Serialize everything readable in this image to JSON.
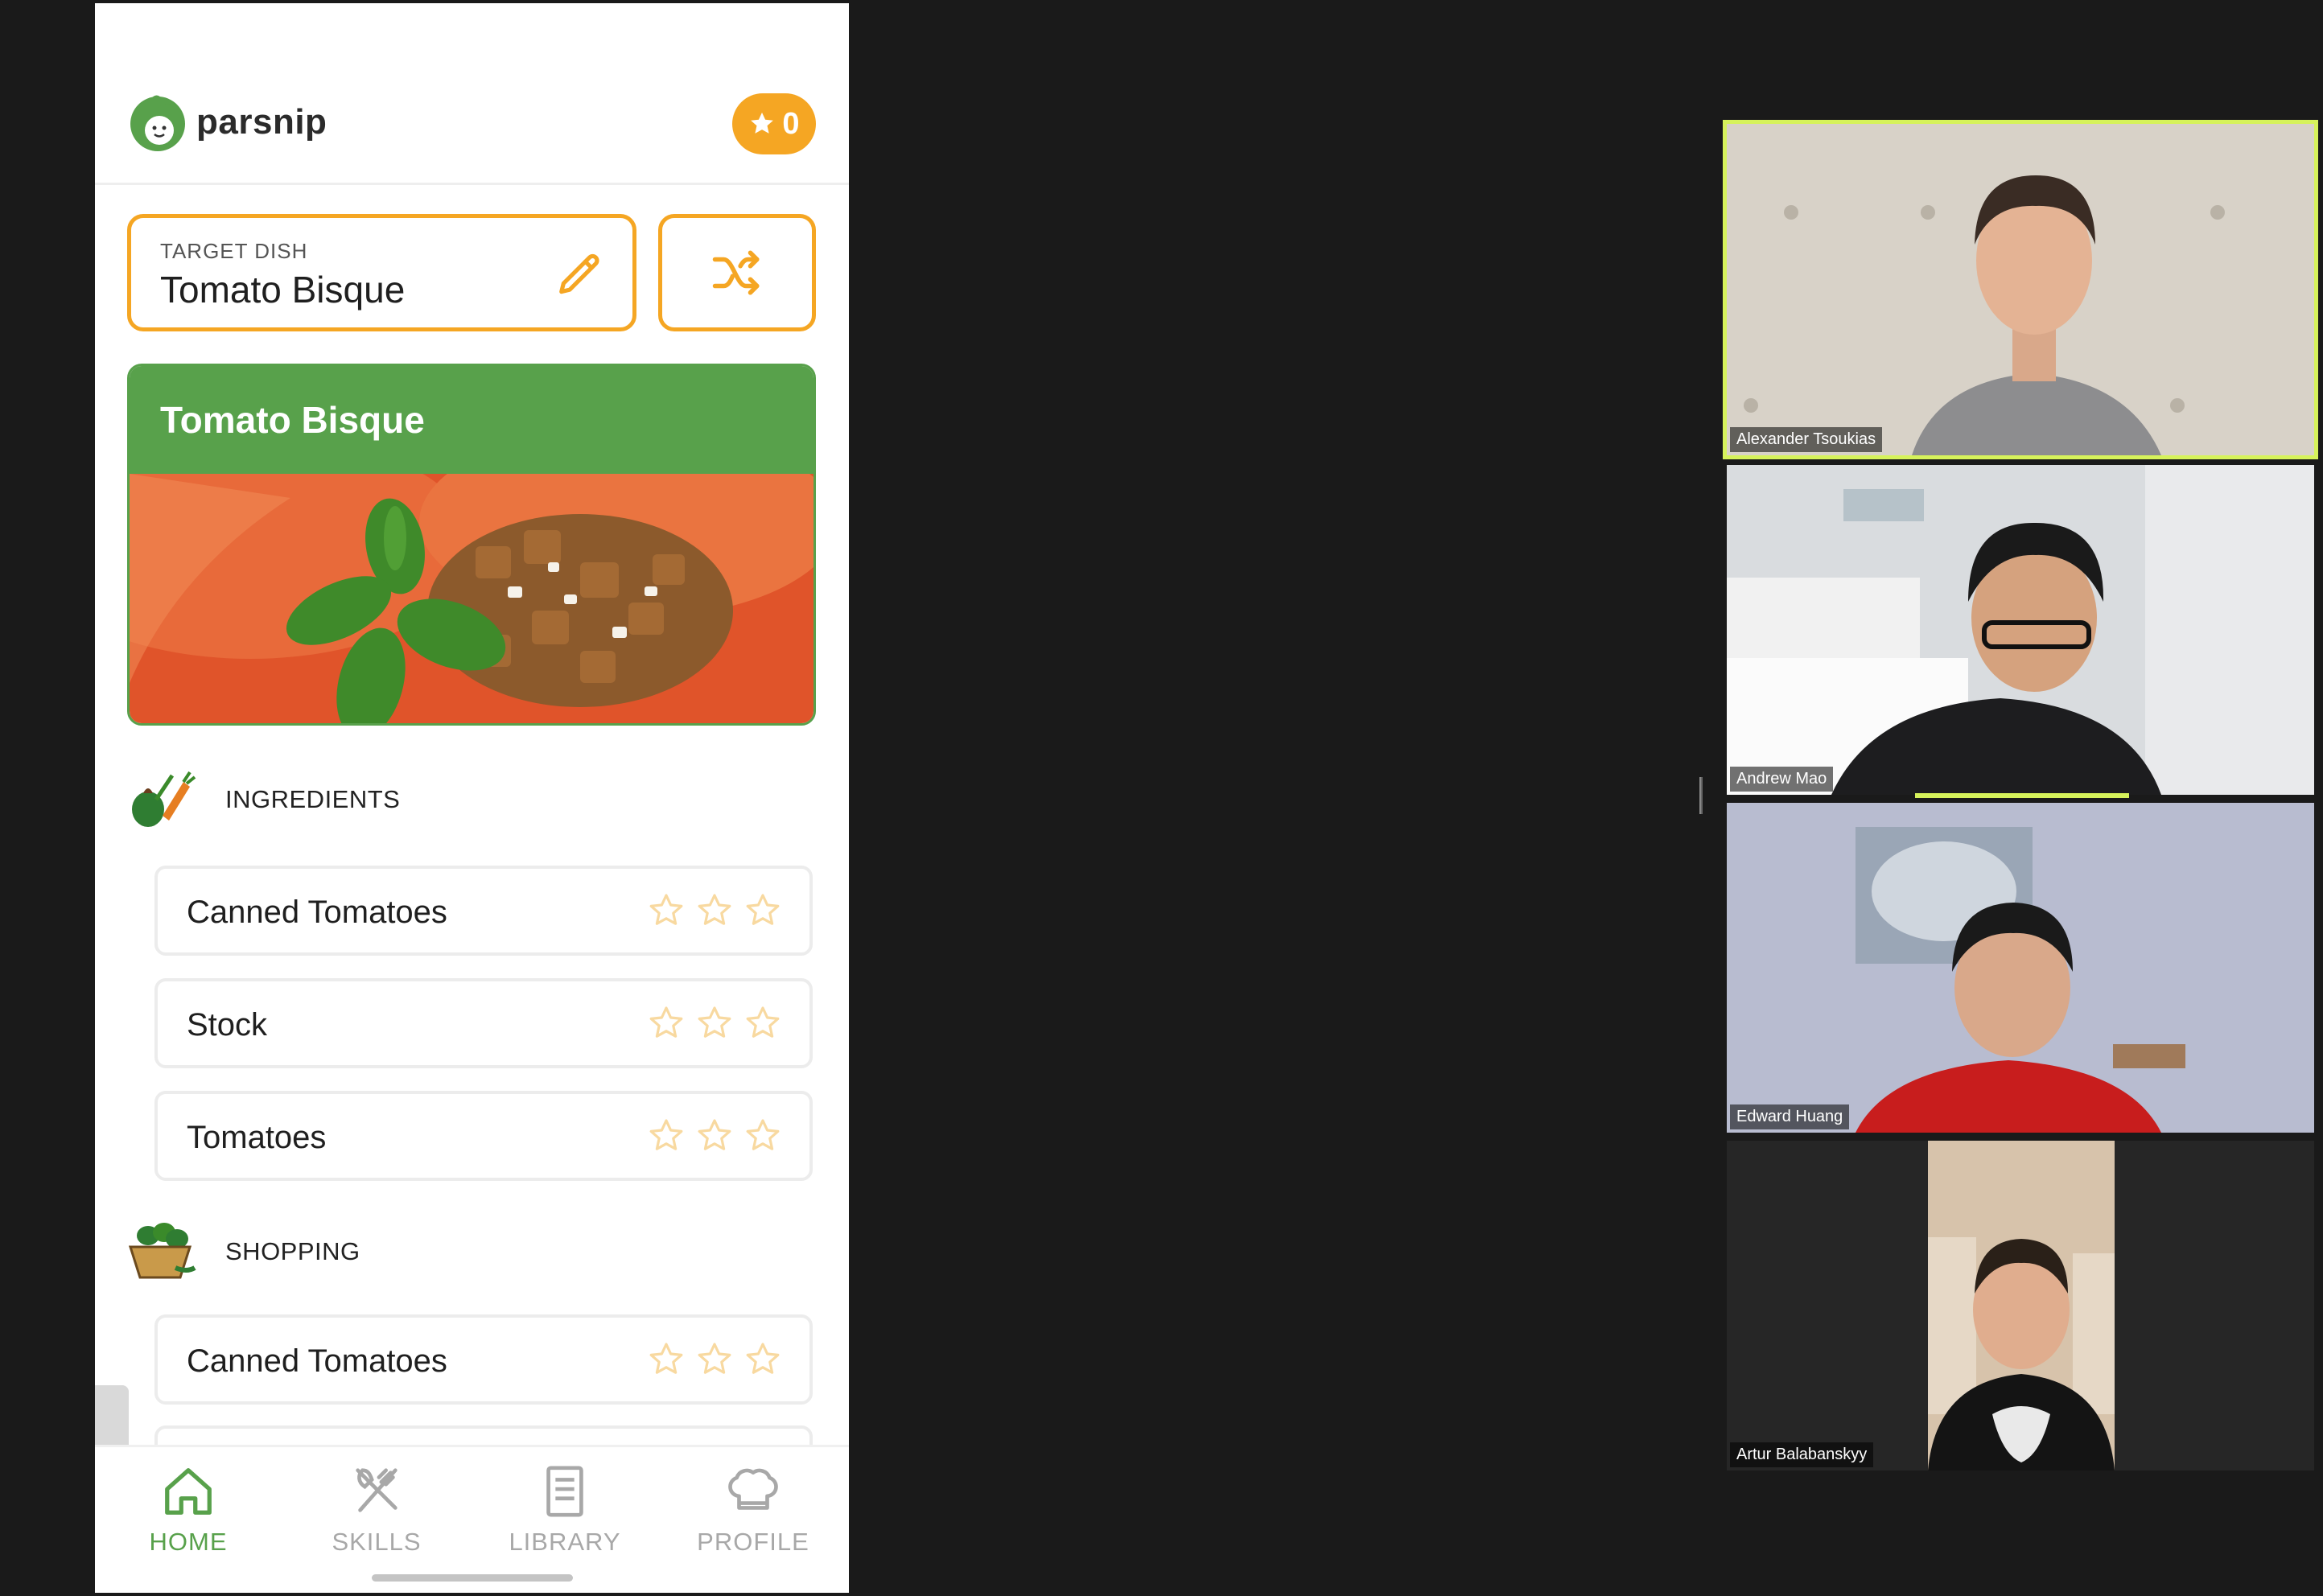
{
  "app": {
    "logo_text": "parsnip",
    "points": "0"
  },
  "target": {
    "label": "TARGET DISH",
    "value": "Tomato Bisque"
  },
  "dish": {
    "title": "Tomato Bisque"
  },
  "sections": {
    "ingredients_label": "INGREDIENTS",
    "shopping_label": "SHOPPING"
  },
  "ingredients": [
    {
      "label": "Canned Tomatoes",
      "rating": 0,
      "max": 3
    },
    {
      "label": "Stock",
      "rating": 0,
      "max": 3
    },
    {
      "label": "Tomatoes",
      "rating": 0,
      "max": 3
    }
  ],
  "shopping": [
    {
      "label": "Canned Tomatoes",
      "rating": 0,
      "max": 3
    }
  ],
  "tabs": [
    {
      "label": "HOME",
      "icon": "home-icon",
      "active": true
    },
    {
      "label": "SKILLS",
      "icon": "utensils-icon",
      "active": false
    },
    {
      "label": "LIBRARY",
      "icon": "book-icon",
      "active": false
    },
    {
      "label": "PROFILE",
      "icon": "chef-hat-icon",
      "active": false
    }
  ],
  "participants": [
    {
      "name": "Alexander Tsoukias",
      "speaking": true
    },
    {
      "name": "Andrew Mao",
      "speaking": false
    },
    {
      "name": "Edward Huang",
      "speaking": false
    },
    {
      "name": "Artur Balabanskyy",
      "speaking": false
    }
  ],
  "colors": {
    "brand_green": "#58a14b",
    "accent_orange": "#f5a623",
    "active_speaker": "#d6f25b"
  }
}
